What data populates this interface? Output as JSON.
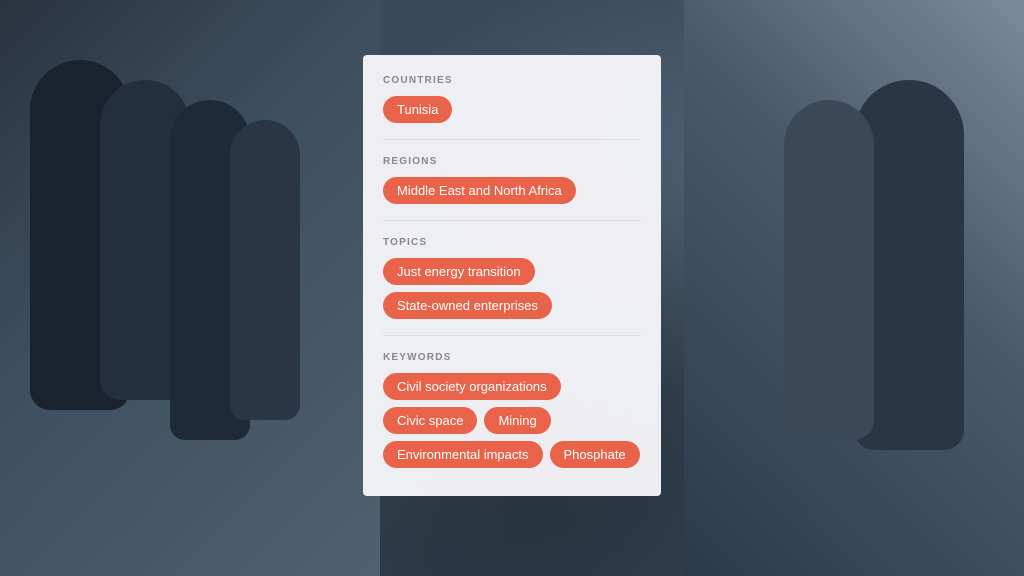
{
  "background": {
    "description": "Dark blurry photo of people standing outdoors"
  },
  "panel": {
    "sections": [
      {
        "id": "countries",
        "label": "COUNTRIES",
        "tags": [
          "Tunisia"
        ]
      },
      {
        "id": "regions",
        "label": "REGIONS",
        "tags": [
          "Middle East and North Africa"
        ]
      },
      {
        "id": "topics",
        "label": "TOPICS",
        "tags": [
          "Just energy transition",
          "State-owned enterprises"
        ]
      },
      {
        "id": "keywords",
        "label": "KEYWORDS",
        "tags": [
          "Civil society organizations",
          "Civic space",
          "Mining",
          "Environmental impacts",
          "Phosphate"
        ]
      }
    ]
  },
  "colors": {
    "tag_bg": "#e8634a",
    "tag_text": "#ffffff",
    "panel_bg": "rgba(245,245,248,0.97)",
    "label_color": "#888888",
    "divider_color": "#e0e0e0"
  }
}
